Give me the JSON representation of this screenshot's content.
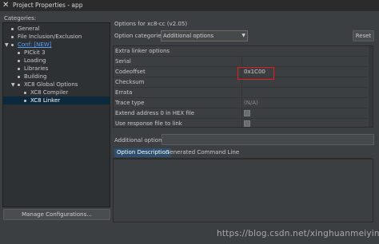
{
  "window": {
    "title": "Project Properties - app"
  },
  "sidebar": {
    "label": "Categories:",
    "items": [
      {
        "label": "General"
      },
      {
        "label": "File Inclusion/Exclusion"
      },
      {
        "label": "Conf: [NEW]"
      },
      {
        "label": "PICkit 3"
      },
      {
        "label": "Loading"
      },
      {
        "label": "Libraries"
      },
      {
        "label": "Building"
      },
      {
        "label": "XC8 Global Options"
      },
      {
        "label": "XC8 Compiler"
      },
      {
        "label": "XC8 Linker"
      }
    ],
    "manage_button": "Manage Configurations..."
  },
  "main": {
    "header": "Options for xc8-cc (v2.05)",
    "option_categories_label": "Option categories:",
    "option_categories_value": "Additional options",
    "reset_button": "Reset",
    "grid": [
      {
        "name": "Extra linker options",
        "value": ""
      },
      {
        "name": "Serial",
        "value": ""
      },
      {
        "name": "Codeoffset",
        "value": "0x1C00"
      },
      {
        "name": "Checksum",
        "value": ""
      },
      {
        "name": "Errata",
        "value": ""
      },
      {
        "name": "Trace type",
        "value": "(N/A)"
      },
      {
        "name": "Extend address 0 in HEX file",
        "value": ""
      },
      {
        "name": "Use response file to link",
        "value": ""
      }
    ],
    "additional_options_label": "Additional options:",
    "additional_options_value": "",
    "tabs": [
      {
        "label": "Option Description"
      },
      {
        "label": "Generated Command Line"
      }
    ]
  },
  "watermark": "https://blog.csdn.net/xinghuanmeiying",
  "colors": {
    "background": "#3c3f41",
    "selection": "#0d293e",
    "link": "#589df6",
    "highlight_box": "#e02020"
  }
}
